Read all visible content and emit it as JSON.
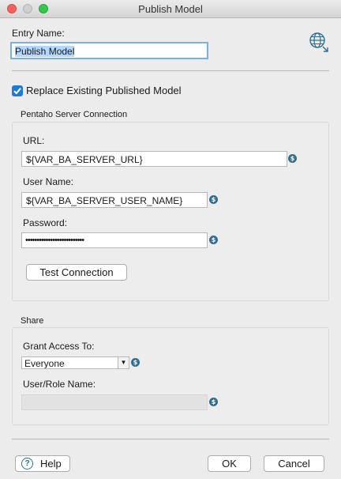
{
  "window": {
    "title": "Publish Model"
  },
  "entry": {
    "label": "Entry Name:",
    "value": "Publish Model"
  },
  "replace": {
    "label": "Replace Existing Published Model",
    "checked": true
  },
  "connection": {
    "group_label": "Pentaho Server Connection",
    "url_label": "URL:",
    "url_value": "${VAR_BA_SERVER_URL}",
    "user_label": "User Name:",
    "user_value": "${VAR_BA_SERVER_USER_NAME}",
    "password_label": "Password:",
    "password_value": "••••••••••••••••••••••••••",
    "test_button": "Test Connection"
  },
  "share": {
    "group_label": "Share",
    "grant_label": "Grant Access To:",
    "grant_value": "Everyone",
    "user_role_label": "User/Role Name:",
    "user_role_value": ""
  },
  "buttons": {
    "help": "Help",
    "ok": "OK",
    "cancel": "Cancel"
  },
  "icons": {
    "variable": "$",
    "help": "?"
  },
  "colors": {
    "accent": "#1f7bd9",
    "selection": "#b3d7ff",
    "variable_icon": "#2e6f95"
  }
}
